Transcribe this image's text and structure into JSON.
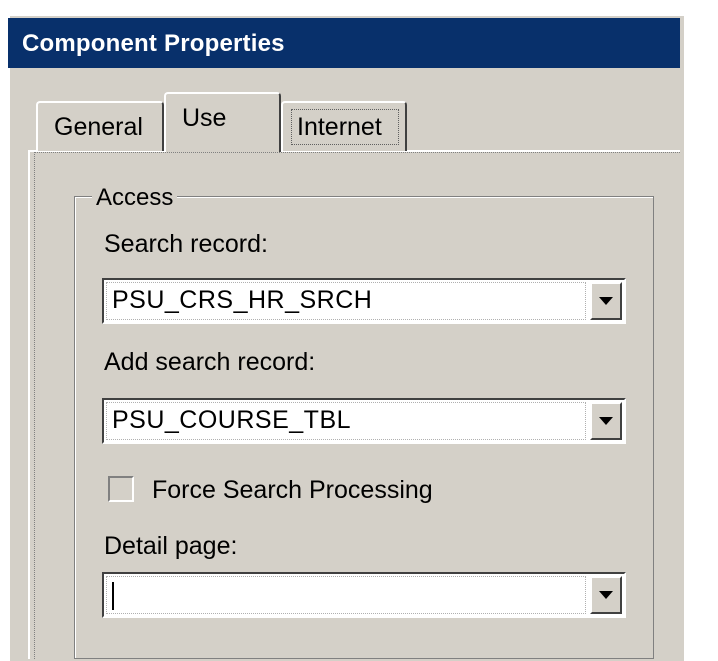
{
  "window": {
    "title": "Component Properties"
  },
  "tabs": [
    {
      "label": "General",
      "active": false
    },
    {
      "label": "Use",
      "active": true
    },
    {
      "label": "Internet",
      "active": false
    }
  ],
  "access_group": {
    "label": "Access",
    "search_record": {
      "label": "Search record:",
      "value": "PSU_CRS_HR_SRCH"
    },
    "add_search_record": {
      "label": "Add search record:",
      "value": "PSU_COURSE_TBL"
    },
    "force_search_processing": {
      "label": "Force Search Processing",
      "checked": false
    },
    "detail_page": {
      "label": "Detail page:",
      "value": ""
    }
  },
  "colors": {
    "titlebar": "#08306b",
    "dialog_face": "#d4d0c8",
    "field_bg": "#ffffff"
  },
  "icons": {
    "dropdown": "chevron-down-icon"
  }
}
